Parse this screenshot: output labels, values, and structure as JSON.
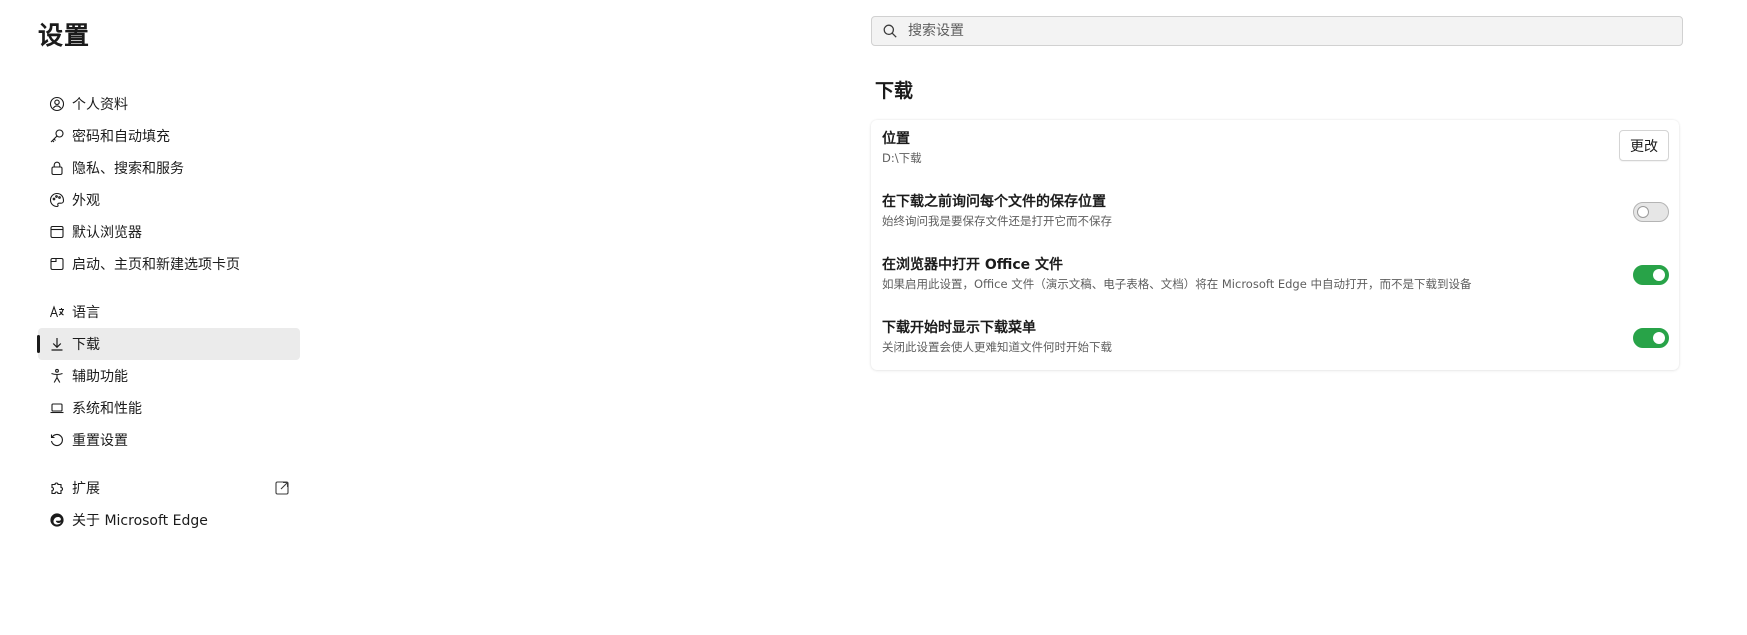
{
  "page_title": "设置",
  "search": {
    "placeholder": "搜索设置"
  },
  "nav": {
    "group1": [
      {
        "label": "个人资料",
        "icon": "profile-icon"
      },
      {
        "label": "密码和自动填充",
        "icon": "key-icon"
      },
      {
        "label": "隐私、搜索和服务",
        "icon": "lock-icon"
      },
      {
        "label": "外观",
        "icon": "palette-icon"
      },
      {
        "label": "默认浏览器",
        "icon": "browser-icon"
      },
      {
        "label": "启动、主页和新建选项卡页",
        "icon": "home-tab-icon"
      }
    ],
    "group2": [
      {
        "label": "语言",
        "icon": "language-icon"
      },
      {
        "label": "下载",
        "icon": "download-icon",
        "active": true
      },
      {
        "label": "辅助功能",
        "icon": "accessibility-icon"
      },
      {
        "label": "系统和性能",
        "icon": "laptop-icon"
      },
      {
        "label": "重置设置",
        "icon": "reset-icon"
      }
    ],
    "group3": [
      {
        "label": "扩展",
        "icon": "puzzle-icon"
      },
      {
        "label": "关于 Microsoft Edge",
        "icon": "edge-logo-icon"
      }
    ]
  },
  "downloads": {
    "section_title": "下载",
    "location": {
      "title": "位置",
      "value": "D:\\下载",
      "button_label": "更改"
    },
    "ask_where": {
      "title": "在下载之前询问每个文件的保存位置",
      "desc": "始终询问我是要保存文件还是打开它而不保存",
      "enabled": false
    },
    "open_office": {
      "title": "在浏览器中打开 Office 文件",
      "desc": "如果启用此设置，Office 文件（演示文稿、电子表格、文档）将在 Microsoft Edge 中自动打开，而不是下载到设备",
      "enabled": true
    },
    "show_menu": {
      "title": "下载开始时显示下载菜单",
      "desc": "关闭此设置会使人更难知道文件何时开始下载",
      "enabled": true
    }
  },
  "colors": {
    "toggle_on": "#28a348",
    "active_bg": "#ebebeb"
  }
}
